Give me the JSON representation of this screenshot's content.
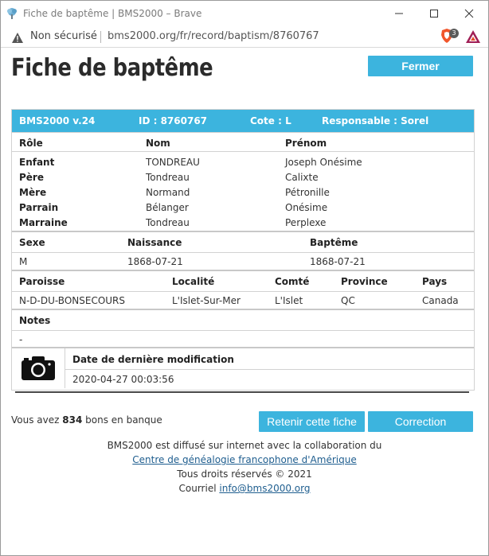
{
  "window": {
    "title": "Fiche de baptême | BMS2000 – Brave",
    "controls": {
      "minimize": "minimize",
      "maximize": "maximize",
      "close": "close"
    }
  },
  "address_bar": {
    "security_label": "Non sécurisé",
    "url": "bms2000.org/fr/record/baptism/8760767",
    "shield_count": "3"
  },
  "page": {
    "title": "Fiche de baptême",
    "close_button": "Fermer"
  },
  "record": {
    "header": {
      "version": "BMS2000 v.24",
      "id": "ID : 8760767",
      "cote": "Cote : L",
      "responsable": "Responsable : Sorel"
    },
    "persons": {
      "columns": [
        "Rôle",
        "Nom",
        "Prénom"
      ],
      "rows": [
        {
          "role": "Enfant",
          "nom": "TONDREAU",
          "prenom": "Joseph Onésime"
        },
        {
          "role": "Père",
          "nom": "Tondreau",
          "prenom": "Calixte"
        },
        {
          "role": "Mère",
          "nom": "Normand",
          "prenom": "Pétronille"
        },
        {
          "role": "Parrain",
          "nom": "Bélanger",
          "prenom": "Onésime"
        },
        {
          "role": "Marraine",
          "nom": "Tondreau",
          "prenom": "Perplexe"
        }
      ]
    },
    "birth": {
      "columns": [
        "Sexe",
        "Naissance",
        "Baptême"
      ],
      "values": [
        "M",
        "1868-07-21",
        "1868-07-21"
      ]
    },
    "place": {
      "columns": [
        "Paroisse",
        "Localité",
        "Comté",
        "Province",
        "Pays"
      ],
      "values": [
        "N-D-DU-BONSECOURS",
        "L'Islet-Sur-Mer",
        "L'Islet",
        "QC",
        "Canada"
      ]
    },
    "notes": {
      "label": "Notes",
      "value": "-"
    },
    "modification": {
      "label": "Date de dernière modification",
      "value": "2020-04-27 00:03:56"
    }
  },
  "actions": {
    "bons_prefix": "Vous avez",
    "bons_count": "834",
    "bons_suffix": "bons en banque",
    "retain_button": "Retenir cette fiche",
    "correction_button": "Correction"
  },
  "footer": {
    "line1": "BMS2000 est diffusé sur internet avec la collaboration du",
    "link_text": "Centre de généalogie francophone d'Amérique",
    "rights": "Tous droits réservés © 2021",
    "email_prefix": "Courriel",
    "email": "info@bms2000.org"
  },
  "colors": {
    "accent": "#3cb4de",
    "divider": "#4a4a4a"
  }
}
